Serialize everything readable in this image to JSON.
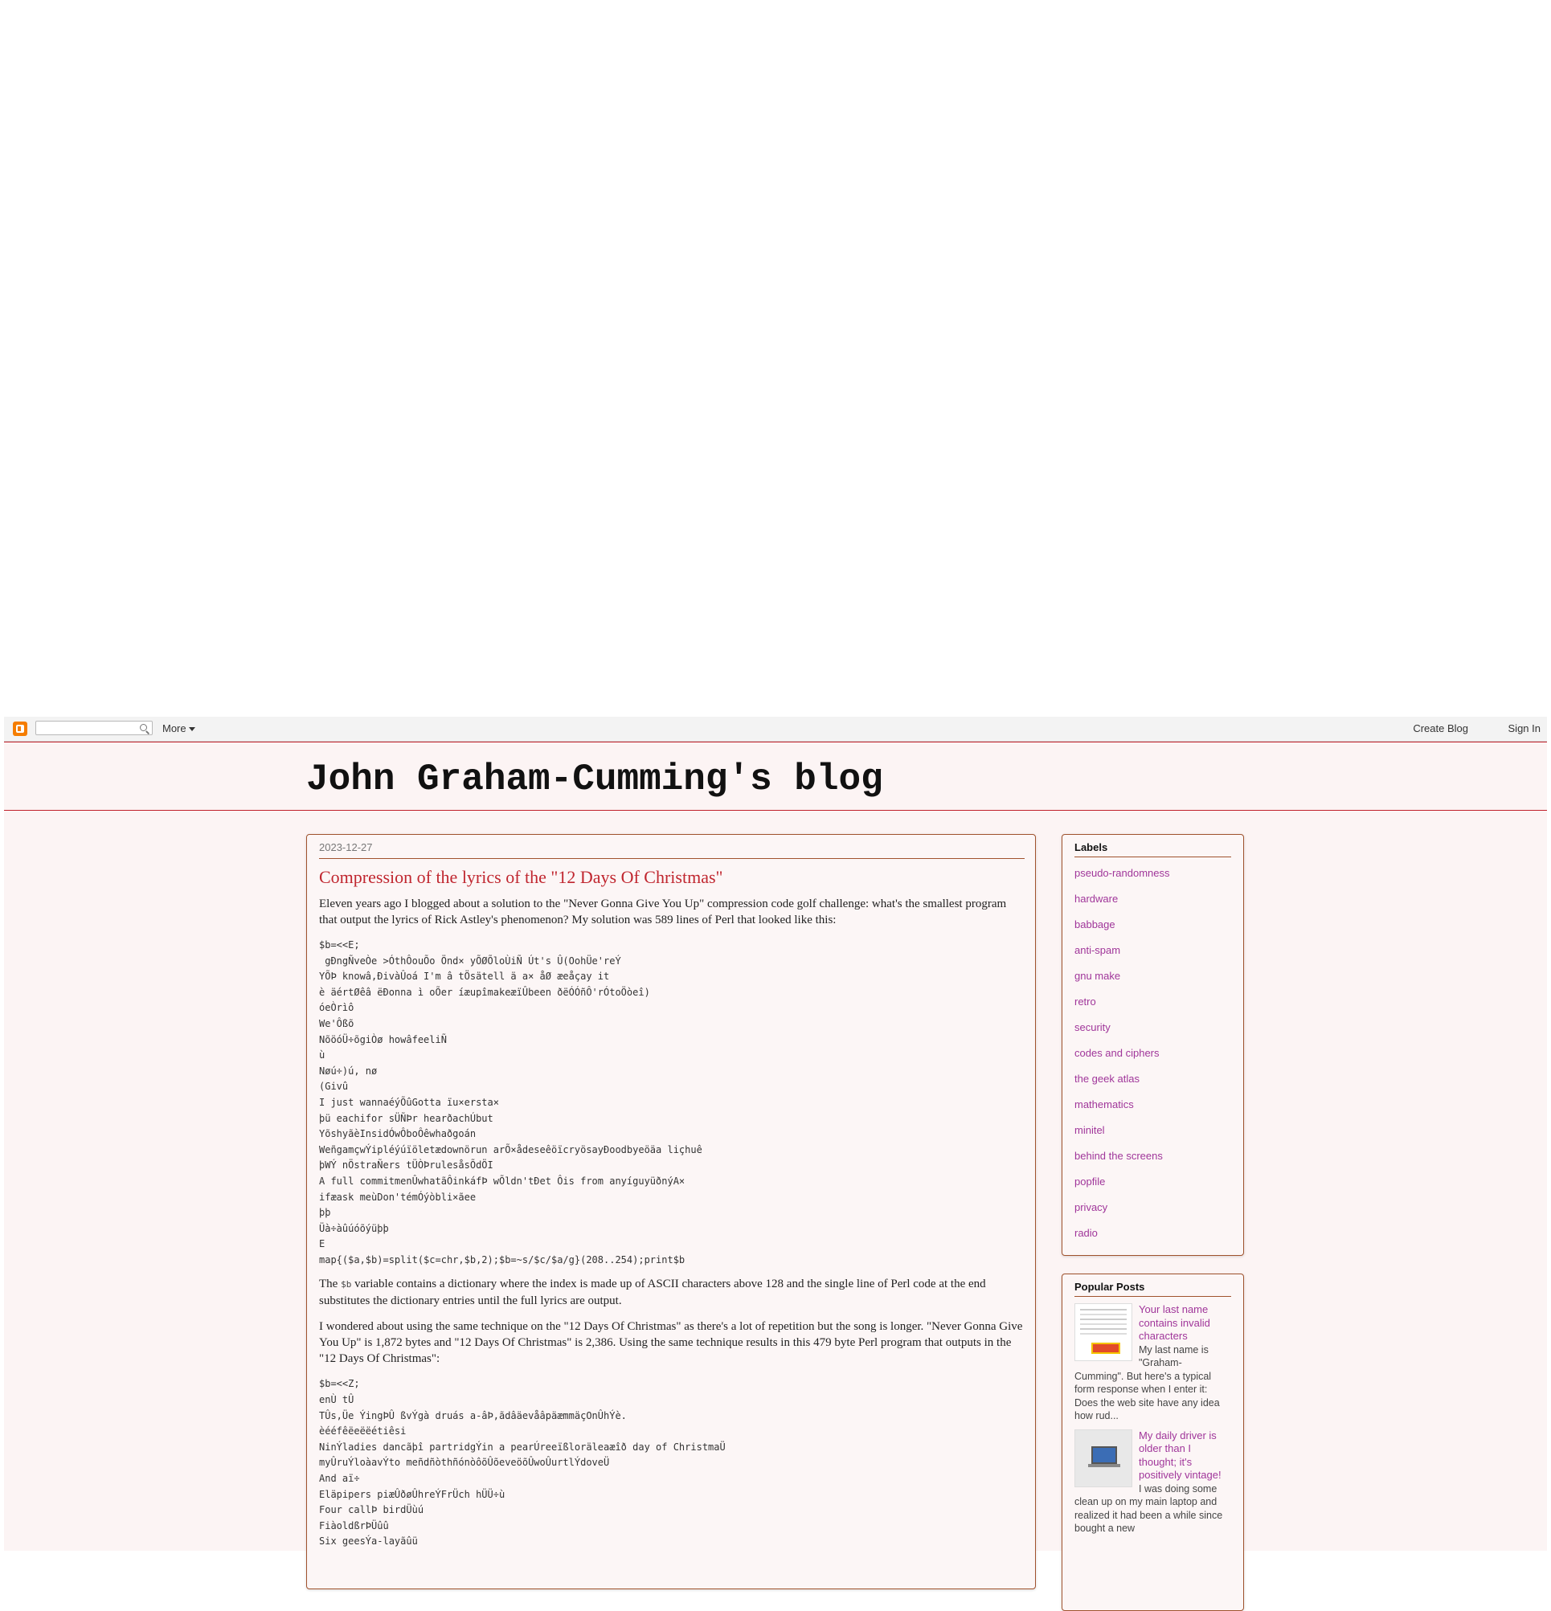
{
  "navbar": {
    "more_label": "More",
    "create_blog_label": "Create Blog",
    "sign_in_label": "Sign In"
  },
  "header": {
    "title": "John Graham-Cumming's blog"
  },
  "post": {
    "date": "2023-12-27",
    "title": "Compression of the lyrics of the \"12 Days Of Christmas\"",
    "para1": "Eleven years ago I blogged about a solution to the \"Never Gonna Give You Up\" compression code golf challenge: what's the smallest program that output the lyrics of Rick Astley's phenomenon? My solution was 589 lines of Perl that looked like this:",
    "code1": "$b=<<E;\n gÐngÑveÒe >ÓthÔouÕo Önd× yÕØÕloÙiÑ Út's Û(OohÜe'reÝ\nYÕÞ knowâ,ÐivàÛoá I'm â tÖsätell ä a× åØ æeåçay it\nè äértØêâ ëÐonna ì oÕer íæupîmakeæïÛbeen ðëÓÓñÔ'rÓtoÖòeî)\nóeÒrìô\nWe'Ôßõ\nNõöóÜ÷õgiÒø howâfeeliÑ\nù\nNøú÷)ú, nø\n(Givû\nI just wannaéýÕûGotta ïu×ersta×\nþü eachifor sÜÑÞr hearðachÚbut\nYõshyãèInsidÓwÔboÔêwhaðgoán\nWeñgamçwÝipléýúïöletædownörun arÕ×ådeseêöïcryösayÐoodbyeöäa liçhuê\nþWÝ nÖstraÑers tÜÒÞrulesåsÕdÖI\nA full commitmenÛwhatãÔinkáfÞ wÕldn'tÐet Ôis from anyíguyüðnýA×\nifæask meùDon'témÓýòbli×ãee\nþþ\nÜà÷àûúóõýüþþ\nE\nmap{($a,$b)=split($c=chr,$b,2);$b=~s/$c/$a/g}(208..254);print$b",
    "para2_pre": "The ",
    "para2_code": "$b",
    "para2_post": " variable contains a dictionary where the index is made up of ASCII characters above 128 and the single line of Perl code at the end substitutes the dictionary entries until the full lyrics are output.",
    "para3": "I wondered about using the same technique on the \"12 Days Of Christmas\" as there's a lot of repetition but the song is longer. \"Never Gonna Give You Up\" is 1,872 bytes and \"12 Days Of Christmas\" is 2,386. Using the same technique results in this 479 byte Perl program that outputs in the \"12 Days Of Christmas\":",
    "code2": "$b=<<Z;\nenÙ tÛ\nTÛs,Üe ÝingÞÛ ßvÝgà druás a-âÞ,ãdâäevåâpäæmmäçOnÛhÝè.\nèééfêëeëëétiêsi\nNinÝladies dancãþî partridgÝin a pearÚreeïßloräleaæîð day of ChristmaÜ\nmyÛruÝloàavÝto meñdñòthñónòôõÛõeveöõÛwoÛurtlÝdoveÜ\nAnd aï÷\nEläpipers piæÛðøÛhreÝFrÜch hÜÜ÷ù\nFour callÞ birdÜùú\nFiàoldßrÞÜûû\nSix geesÝa-layãûü"
  },
  "labels": {
    "title": "Labels",
    "items": [
      "pseudo-randomness",
      "hardware",
      "babbage",
      "anti-spam",
      "gnu make",
      "retro",
      "security",
      "codes and ciphers",
      "the geek atlas",
      "mathematics",
      "minitel",
      "behind the screens",
      "popfile",
      "privacy",
      "radio"
    ]
  },
  "popular": {
    "title": "Popular Posts",
    "items": [
      {
        "title": "Your last name contains invalid characters",
        "snippet": "My last name is \"Graham-Cumming\". But here's a typical form response when I enter it: Does the web site have any idea how rud..."
      },
      {
        "title": "My daily driver is older than I thought; it's positively vintage!",
        "snippet": "I was doing some clean up on my main laptop and realized it had been a while since bought a new"
      }
    ]
  }
}
